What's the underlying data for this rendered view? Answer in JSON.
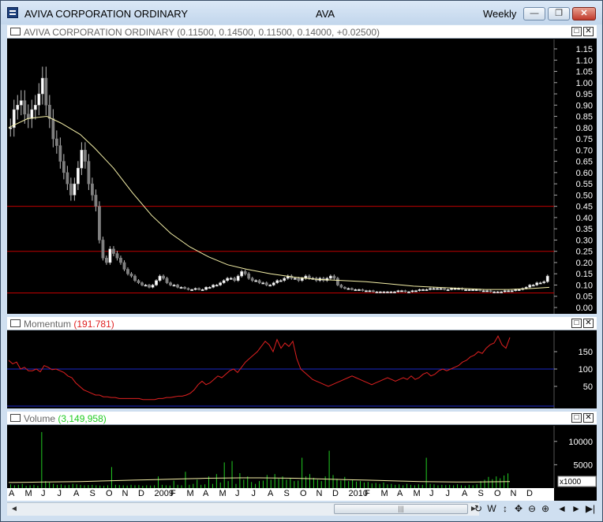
{
  "window": {
    "title": "AVIVA CORPORATION ORDINARY",
    "code": "AVA",
    "period": "Weekly",
    "minimize_glyph": "—",
    "restore_glyph": "❐",
    "close_glyph": "✕"
  },
  "price_panel": {
    "name": "AVIVA CORPORATION ORDINARY",
    "values": "(0.11500, 0.14500, 0.11500, 0.14000, +0.02500)",
    "y_ticks": [
      "1.15",
      "1.10",
      "1.05",
      "1.00",
      "0.95",
      "0.90",
      "0.85",
      "0.80",
      "0.75",
      "0.70",
      "0.65",
      "0.60",
      "0.55",
      "0.50",
      "0.45",
      "0.40",
      "0.35",
      "0.30",
      "0.25",
      "0.20",
      "0.15",
      "0.10",
      "0.05",
      "0.00"
    ],
    "y_min": 0.0,
    "y_max": 1.15,
    "hlines": [
      0.45,
      0.25,
      0.065
    ],
    "hline_color": "#c00000",
    "ma_color": "#f5f0a8",
    "ma": [
      [
        0,
        0.8
      ],
      [
        8,
        0.84
      ],
      [
        16,
        0.85
      ],
      [
        22,
        0.82
      ],
      [
        30,
        0.77
      ],
      [
        36,
        0.71
      ],
      [
        44,
        0.62
      ],
      [
        52,
        0.51
      ],
      [
        60,
        0.41
      ],
      [
        68,
        0.33
      ],
      [
        76,
        0.27
      ],
      [
        84,
        0.225
      ],
      [
        92,
        0.19
      ],
      [
        100,
        0.17
      ],
      [
        110,
        0.15
      ],
      [
        120,
        0.135
      ],
      [
        130,
        0.125
      ],
      [
        140,
        0.12
      ],
      [
        150,
        0.115
      ],
      [
        160,
        0.105
      ],
      [
        170,
        0.095
      ],
      [
        180,
        0.09
      ],
      [
        190,
        0.085
      ],
      [
        200,
        0.08
      ],
      [
        210,
        0.08
      ],
      [
        220,
        0.085
      ],
      [
        227,
        0.09
      ]
    ],
    "candles_x_range": [
      0,
      227
    ],
    "close_series": [
      0.8,
      0.88,
      0.9,
      0.92,
      0.86,
      0.84,
      0.88,
      0.9,
      0.95,
      1.02,
      0.9,
      0.84,
      0.75,
      0.72,
      0.65,
      0.6,
      0.55,
      0.5,
      0.55,
      0.62,
      0.7,
      0.65,
      0.55,
      0.5,
      0.45,
      0.3,
      0.22,
      0.2,
      0.26,
      0.24,
      0.22,
      0.2,
      0.17,
      0.15,
      0.14,
      0.12,
      0.11,
      0.1,
      0.1,
      0.09,
      0.1,
      0.12,
      0.14,
      0.13,
      0.11,
      0.1,
      0.1,
      0.09,
      0.09,
      0.085,
      0.08,
      0.08,
      0.085,
      0.08,
      0.08,
      0.09,
      0.09,
      0.1,
      0.1,
      0.11,
      0.12,
      0.13,
      0.13,
      0.12,
      0.14,
      0.16,
      0.15,
      0.13,
      0.12,
      0.12,
      0.11,
      0.11,
      0.1,
      0.1,
      0.11,
      0.12,
      0.12,
      0.13,
      0.14,
      0.13,
      0.13,
      0.12,
      0.13,
      0.14,
      0.13,
      0.13,
      0.12,
      0.13,
      0.12,
      0.13,
      0.14,
      0.13,
      0.1,
      0.09,
      0.085,
      0.085,
      0.08,
      0.08,
      0.08,
      0.075,
      0.075,
      0.075,
      0.07,
      0.07,
      0.07,
      0.07,
      0.07,
      0.07,
      0.07,
      0.075,
      0.075,
      0.07,
      0.07,
      0.075,
      0.075,
      0.08,
      0.08,
      0.08,
      0.085,
      0.085,
      0.085,
      0.085,
      0.08,
      0.08,
      0.085,
      0.085,
      0.085,
      0.08,
      0.08,
      0.08,
      0.08,
      0.08,
      0.075,
      0.075,
      0.075,
      0.07,
      0.07,
      0.07,
      0.07,
      0.075,
      0.075,
      0.075,
      0.08,
      0.08,
      0.085,
      0.09,
      0.1,
      0.1,
      0.11,
      0.11,
      0.115,
      0.14
    ]
  },
  "momentum_panel": {
    "name": "Momentum",
    "value": "(191.781)",
    "value_color": "#e02020",
    "y_ticks": [
      "150",
      "100",
      "50"
    ],
    "y_min": 0,
    "y_max": 200,
    "ref_line": 100,
    "series": [
      125,
      115,
      120,
      100,
      105,
      95,
      95,
      100,
      92,
      110,
      105,
      98,
      100,
      95,
      90,
      80,
      75,
      60,
      50,
      40,
      35,
      30,
      25,
      25,
      20,
      20,
      18,
      18,
      15,
      15,
      15,
      15,
      15,
      15,
      12,
      12,
      12,
      12,
      15,
      15,
      18,
      18,
      20,
      22,
      22,
      25,
      30,
      40,
      55,
      65,
      55,
      60,
      70,
      80,
      75,
      85,
      95,
      100,
      90,
      105,
      120,
      130,
      140,
      150,
      165,
      180,
      170,
      150,
      185,
      160,
      175,
      165,
      180,
      130,
      100,
      90,
      80,
      70,
      65,
      60,
      55,
      50,
      55,
      60,
      65,
      70,
      75,
      80,
      75,
      70,
      65,
      60,
      55,
      60,
      65,
      70,
      75,
      70,
      65,
      70,
      75,
      70,
      80,
      70,
      75,
      85,
      90,
      80,
      85,
      95,
      100,
      95,
      100,
      105,
      110,
      120,
      125,
      135,
      140,
      150,
      145,
      160,
      170,
      175,
      195,
      170,
      160,
      191
    ]
  },
  "volume_panel": {
    "name": "Volume",
    "value": "(3,149,958)",
    "value_color": "#22cc22",
    "y_ticks": [
      "10000",
      "5000"
    ],
    "y_min": 0,
    "y_max": 13000,
    "unit": "x1000",
    "bars": [
      800,
      600,
      700,
      900,
      500,
      600,
      700,
      500,
      12000,
      1500,
      1200,
      900,
      700,
      800,
      600,
      700,
      900,
      800,
      700,
      600,
      650,
      700,
      600,
      550,
      500,
      600,
      4500,
      700,
      650,
      600,
      550,
      700,
      600,
      650,
      500,
      600,
      550,
      600,
      2500,
      700,
      600,
      550,
      1600,
      700,
      600,
      3500,
      700,
      900,
      1800,
      700,
      800,
      2500,
      900,
      3000,
      1200,
      5500,
      1500,
      5800,
      900,
      3200,
      1800,
      2500,
      1300,
      900,
      1500,
      1600,
      2800,
      1800,
      3000,
      2000,
      2500,
      1800,
      2200,
      1500,
      1600,
      6500,
      2500,
      3000,
      2200,
      1800,
      1500,
      2500,
      8000,
      2800,
      2000,
      1600,
      2400,
      1500,
      1800,
      1400,
      1500,
      1200,
      1300,
      1000,
      1100,
      900,
      1200,
      800,
      900,
      700,
      800,
      600,
      900,
      700,
      600,
      800,
      700,
      6500,
      900,
      800,
      600,
      700,
      650,
      700,
      600,
      800,
      600,
      500,
      700,
      600,
      800,
      1500,
      1800,
      2400,
      1900,
      2500,
      2100,
      2700,
      3149
    ],
    "ma_color": "#f5f0a8",
    "ma": [
      1200,
      1250,
      1300,
      1350,
      1400,
      1500,
      1600,
      1700,
      1800,
      1900,
      2000,
      2100,
      2150,
      2200,
      2200,
      2150,
      2100,
      2000,
      1900,
      1800,
      1700,
      1600,
      1500,
      1400,
      1350,
      1300,
      1300,
      1350,
      1400
    ]
  },
  "x_axis": {
    "labels": [
      "A",
      "M",
      "J",
      "J",
      "A",
      "S",
      "O",
      "N",
      "D",
      "2009",
      "F",
      "M",
      "A",
      "M",
      "J",
      "J",
      "A",
      "S",
      "O",
      "N",
      "D",
      "2010",
      "F",
      "M",
      "A",
      "M",
      "J",
      "J",
      "A",
      "S",
      "O",
      "N",
      "D"
    ]
  },
  "scrollbar": {
    "left_arrow": "◄",
    "right_arrow": "►",
    "thumb_grip": "|||"
  },
  "toolbar": {
    "refresh": "↻",
    "week": "W",
    "updown": "↕",
    "pan": "✥",
    "zoom_out": "⊖",
    "zoom_in": "⊕",
    "prev": "◄",
    "next": "►",
    "end": "▶|"
  },
  "panel_buttons": {
    "maximize": "□",
    "close": "✕"
  }
}
